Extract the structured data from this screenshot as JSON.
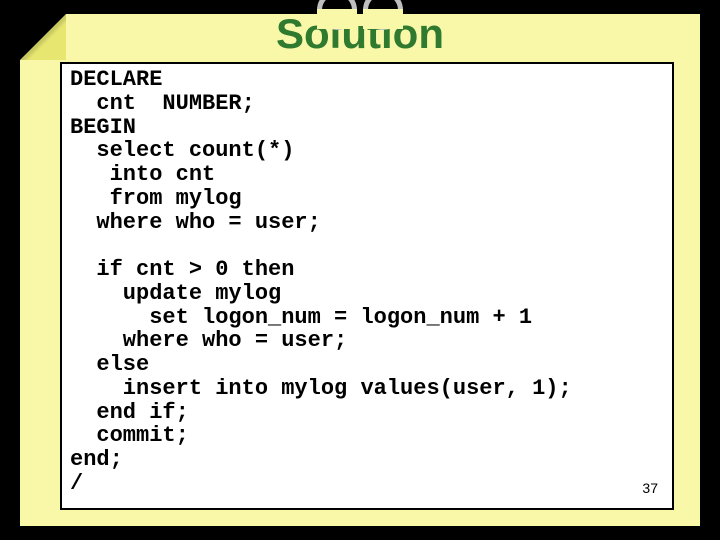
{
  "title": "Solution",
  "code": "DECLARE\n  cnt  NUMBER;\nBEGIN\n  select count(*)\n   into cnt\n   from mylog\n  where who = user;\n\n  if cnt > 0 then\n    update mylog\n      set logon_num = logon_num + 1\n    where who = user;\n  else\n    insert into mylog values(user, 1);\n  end if;\n  commit;\nend;\n/",
  "slide_number": "37"
}
